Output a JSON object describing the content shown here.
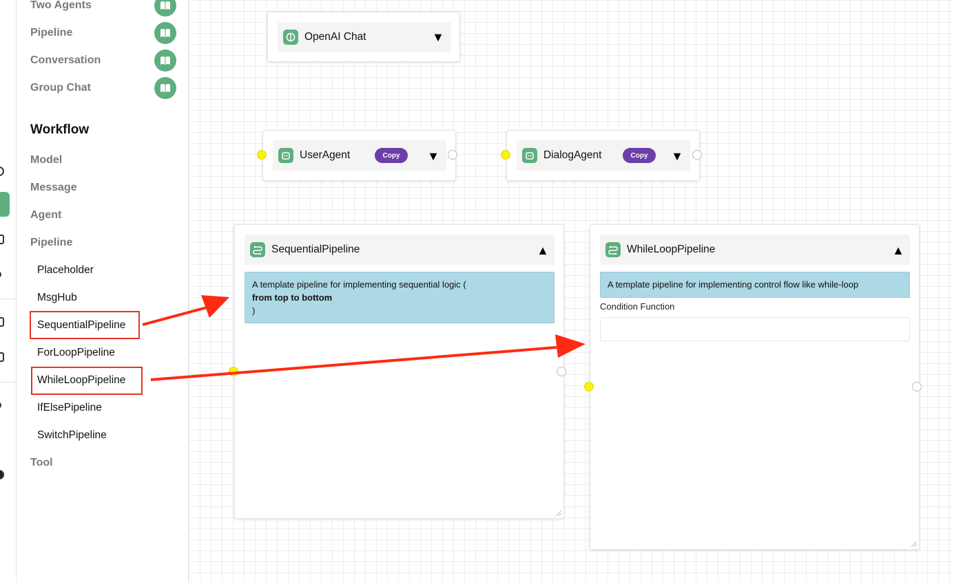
{
  "sidebar": {
    "examples": [
      {
        "label": "Two Agents",
        "icon": "book-icon"
      },
      {
        "label": "Pipeline",
        "icon": "book-icon"
      },
      {
        "label": "Conversation",
        "icon": "book-icon"
      },
      {
        "label": "Group Chat",
        "icon": "book-icon"
      }
    ],
    "workflow_title": "Workflow",
    "categories": {
      "model": "Model",
      "message": "Message",
      "agent": "Agent",
      "pipeline": "Pipeline",
      "tool": "Tool"
    },
    "pipeline_items": [
      "Placeholder",
      "MsgHub",
      "SequentialPipeline",
      "ForLoopPipeline",
      "WhileLoopPipeline",
      "IfElsePipeline",
      "SwitchPipeline"
    ]
  },
  "canvas": {
    "openai_node": {
      "title": "OpenAI Chat",
      "toggle": "▼"
    },
    "user_agent_node": {
      "title": "UserAgent",
      "copy_label": "Copy",
      "toggle": "▼"
    },
    "dialog_agent_node": {
      "title": "DialogAgent",
      "copy_label": "Copy",
      "toggle": "▼"
    },
    "sequential_node": {
      "title": "SequentialPipeline",
      "toggle": "▲",
      "desc_line1": "A template pipeline for implementing sequential logic (",
      "desc_line2": "from top to bottom",
      "desc_line3": ")"
    },
    "while_node": {
      "title": "WhileLoopPipeline",
      "toggle": "▲",
      "desc": "A template pipeline for implementing control flow like while-loop",
      "condition_label": "Condition Function",
      "condition_value": ""
    }
  },
  "colors": {
    "accent_green": "#5fae7f",
    "copy_purple": "#6b3fa8",
    "desc_blue": "#add8e6",
    "handle_yellow": "#f7f212",
    "annotation_red": "#e53323"
  }
}
